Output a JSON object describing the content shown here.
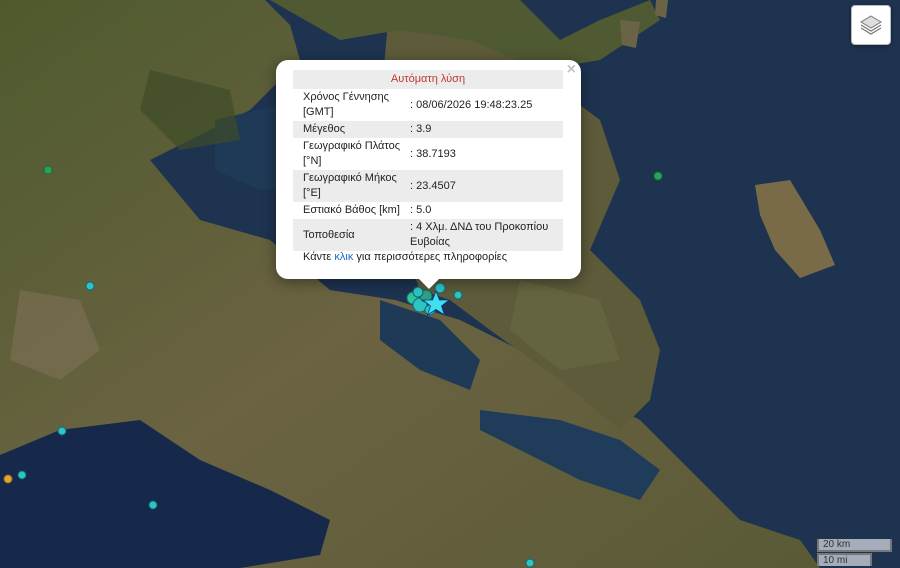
{
  "popup": {
    "header": "Αυτόματη λύση",
    "close_symbol": "×",
    "rows": [
      {
        "label": "Χρόνος Γέννησης [GMT]",
        "value": ": 08/06/2026 19:48:23.25"
      },
      {
        "label": "Μέγεθος",
        "value": ": 3.9"
      },
      {
        "label": "Γεωγραφικό Πλάτος [°N]",
        "value": ": 38.7193"
      },
      {
        "label": "Γεωγραφικό Μήκος [°E]",
        "value": ": 23.4507"
      },
      {
        "label": "Εστιακό Βάθος [km]",
        "value": ": 5.0"
      },
      {
        "label": "Τοποθεσία",
        "value": ": 4 Χλμ. ΔΝΔ του Προκοπίου Ευβοίας"
      }
    ],
    "more_prefix": "Κάντε",
    "more_link": "κλικ",
    "more_suffix": "για περισσότερες πληροφορίες"
  },
  "scale": {
    "km": "20 km",
    "mi": "10 mi"
  },
  "layers_icon": "layers-icon",
  "epicenter_icon": "star-icon",
  "colors": {
    "sea": "#1d3350",
    "land": "#5f5a38",
    "marker_recent": "#2ec4c4",
    "marker_older": "#2e9e5e",
    "marker_old": "#e0a92a",
    "epicenter": "#3ee0f0",
    "popup_header": "#c0392b"
  }
}
